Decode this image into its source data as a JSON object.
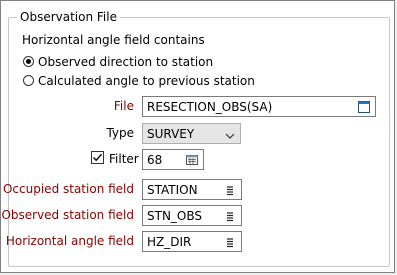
{
  "group": {
    "title": "Observation File"
  },
  "horizontal_angle": {
    "heading": "Horizontal angle field contains",
    "options": [
      {
        "label": "Observed direction to station",
        "selected": true
      },
      {
        "label": "Calculated angle to previous station",
        "selected": false
      }
    ]
  },
  "file": {
    "label": "File",
    "value": "RESECTION_OBS(SA)",
    "icon": "file-browse-icon"
  },
  "type": {
    "label": "Type",
    "value": "SURVEY"
  },
  "filter": {
    "label": "Filter",
    "checked": true,
    "value": "68",
    "icon": "filter-list-icon"
  },
  "fields": [
    {
      "label": "Occupied station field",
      "value": "STATION",
      "icon": "field-list-icon"
    },
    {
      "label": "Observed station field",
      "value": "STN_OBS",
      "icon": "field-list-icon"
    },
    {
      "label": "Horizontal angle field",
      "value": "HZ_DIR",
      "icon": "field-list-icon"
    }
  ],
  "colors": {
    "required_label": "#8b0000",
    "border": "#7a7a7a",
    "combo_bg": "#e5e5e5"
  }
}
